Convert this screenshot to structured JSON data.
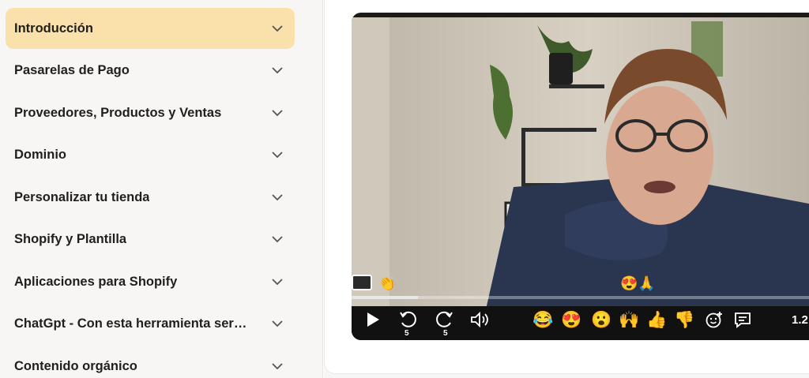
{
  "sidebar": {
    "modules": [
      {
        "label": "Introducción",
        "active": true
      },
      {
        "label": "Pasarelas de Pago",
        "active": false
      },
      {
        "label": "Proveedores, Productos y Ventas",
        "active": false
      },
      {
        "label": "Dominio",
        "active": false
      },
      {
        "label": "Personalizar tu tienda",
        "active": false
      },
      {
        "label": "Shopify y Plantilla",
        "active": false
      },
      {
        "label": "Aplicaciones para Shopify",
        "active": false
      },
      {
        "label": "ChatGpt - Con esta herramienta ser…",
        "active": false
      },
      {
        "label": "Contenido orgánico",
        "active": false
      }
    ]
  },
  "player": {
    "progress_fraction": 0.14,
    "rewind_seconds": "5",
    "forward_seconds": "5",
    "speed_label": "1.2",
    "reactions": [
      "😂",
      "😍",
      "😮",
      "🙌",
      "👍",
      "👎"
    ],
    "floating_reactions": [
      "👏",
      "😍🙏"
    ]
  },
  "colors": {
    "active_module_bg": "#fae0ab",
    "sidebar_bg": "#f8f6f4"
  }
}
